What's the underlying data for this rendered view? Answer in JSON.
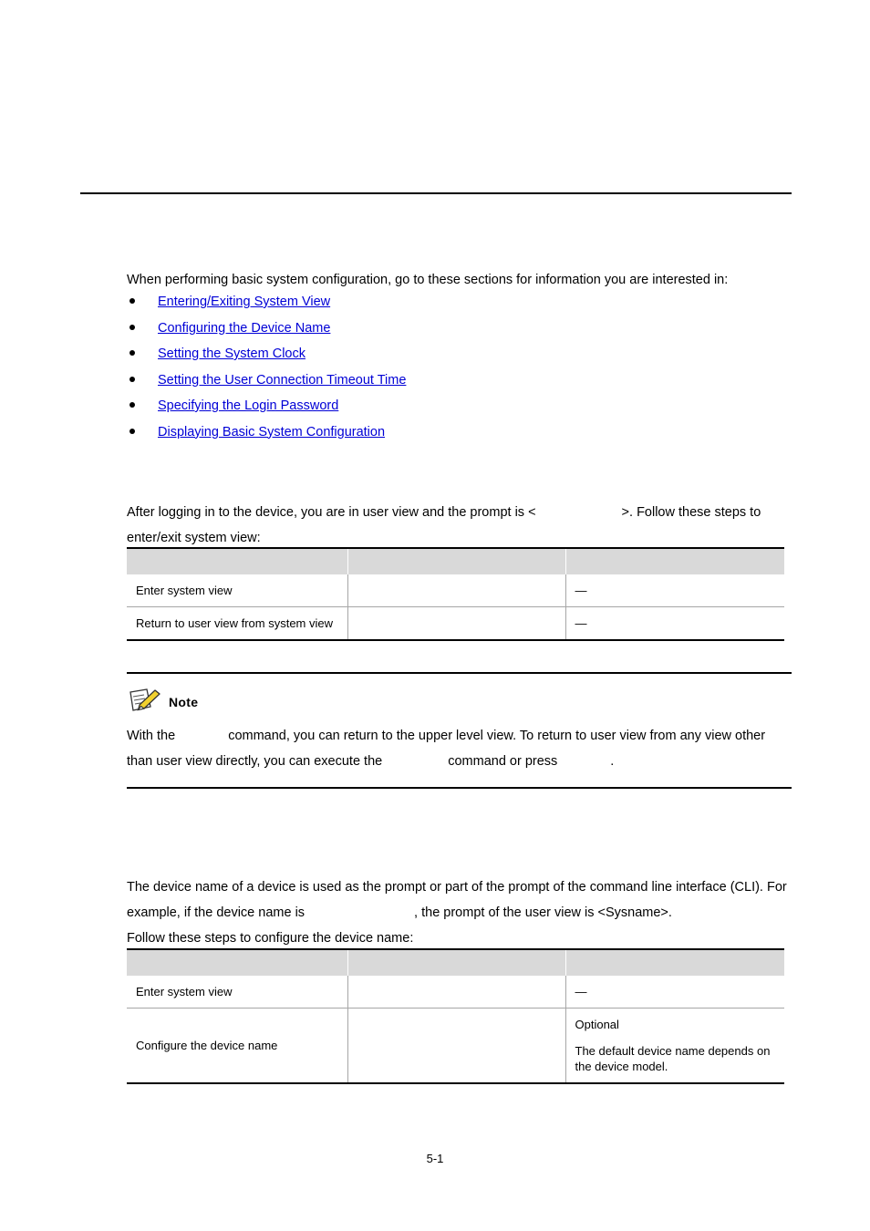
{
  "document": {
    "page_number": "5-1",
    "chapter_heading": "",
    "colors": {
      "link": "#0000d6",
      "table_header_bg": "#d9d9d9",
      "rule": "#000000",
      "note_pencil": "#f2d12e"
    }
  },
  "intro": {
    "lead_in": "When performing basic system configuration, go to these sections for information you are interested in:",
    "links": [
      {
        "label": "Entering/Exiting System View"
      },
      {
        "label": "Configuring the Device Name"
      },
      {
        "label": "Setting the System Clock"
      },
      {
        "label": "Setting the User Connection Timeout Time"
      },
      {
        "label": "Specifying the Login Password"
      },
      {
        "label": "Displaying Basic System Configuration"
      }
    ]
  },
  "entering_exiting_system_view": {
    "heading": "",
    "paragraph_part1": "After logging in to the device, you are in user view and the prompt is <",
    "paragraph_part2": ">. Follow these steps to enter/exit system view:",
    "table": {
      "headers": [
        "",
        "",
        ""
      ],
      "rows": [
        {
          "operation": "Enter system view",
          "command": "",
          "remarks": [
            "—"
          ]
        },
        {
          "operation": "Return to user view from system view",
          "command": "",
          "remarks": [
            "—"
          ]
        }
      ]
    }
  },
  "note": {
    "icon": "note-pencil-icon",
    "title": "Note",
    "text_part1": "With the",
    "text_part2": "command, you can return to the upper level view. To return to user view from any view other than user view directly, you can execute the",
    "text_part3": "command or press",
    "text_part4": "."
  },
  "configuring_the_device_name": {
    "heading": "",
    "paragraph_part1": "The device name of a device is used as the prompt or part of the prompt of the command line interface (CLI). For example, if the device name is",
    "paragraph_part2": ", the prompt of the user view is <Sysname>.",
    "paragraph_part3": "Follow these steps to configure the device name:",
    "table": {
      "headers": [
        "",
        "",
        ""
      ],
      "rows": [
        {
          "operation": "Enter system view",
          "command": "",
          "remarks": [
            "—"
          ]
        },
        {
          "operation": "Configure the device name",
          "command": "",
          "remarks": [
            "Optional",
            "The default device name depends on the device model."
          ]
        }
      ]
    }
  }
}
